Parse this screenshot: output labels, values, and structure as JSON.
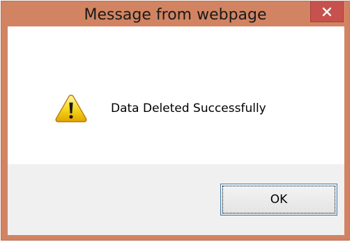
{
  "window": {
    "title": "Message from webpage",
    "accent_color": "#d28462",
    "close_color": "#c7514c"
  },
  "dialog": {
    "icon": "warning-icon",
    "message": "Data Deleted Successfully",
    "ok_label": "OK"
  }
}
